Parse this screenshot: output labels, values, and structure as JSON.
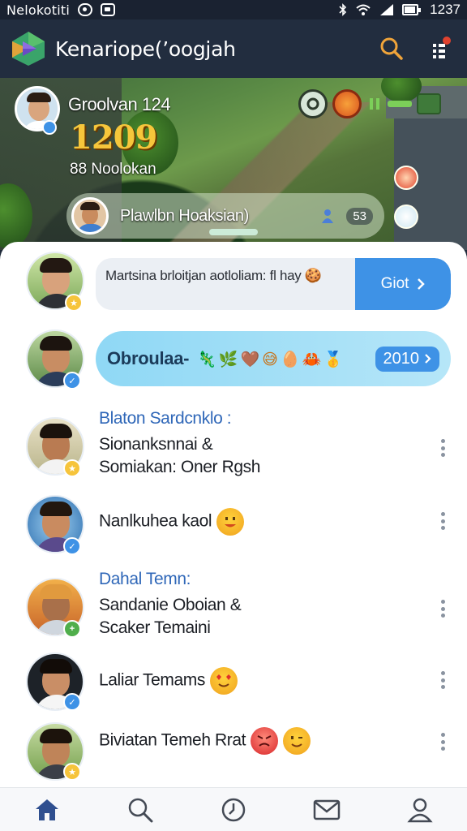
{
  "status_bar": {
    "carrier": "Nelokotiti",
    "time": "1237"
  },
  "app_bar": {
    "title": "Kenariope(’oogjah"
  },
  "banner": {
    "hero_name": "Groolvan 124",
    "hero_score": "1209",
    "hero_subtitle": "88 Noolokan",
    "chip_text": "Plawlbn Hoaksian)",
    "chip_count": "53"
  },
  "feed": {
    "message_card": {
      "text": "Martsina brloitjan aotloliam: fl hay 🍪",
      "button_label": "Giot"
    },
    "emoji_card": {
      "label": "Obroulaa-",
      "emojis": "🦎🌿🤎😅🥚🦀🥇",
      "count": "2010"
    },
    "items": [
      {
        "title": "Blaton Sardcnklo :",
        "line1": "Sionanksnnai &",
        "line2": "Somiakan: Oner Rgsh"
      },
      {
        "title": "",
        "line1": "Nanlkuhea kaol",
        "line2": ""
      },
      {
        "title": "Dahal Temn:",
        "line1": "Sandanie Oboian &",
        "line2": "Scaker Temaini"
      },
      {
        "title": "",
        "line1": "Laliar Temams",
        "line2": ""
      },
      {
        "title": "",
        "line1": "Biviatan Temeh Rrat",
        "line2": ""
      }
    ]
  },
  "colors": {
    "accent": "#3e92e6",
    "app_bar": "#222d3f",
    "title_blue": "#2f67b8"
  },
  "icons": {
    "app_logo": "play-triangle-logo-icon",
    "search": "search-icon",
    "menu": "menu-dots-icon",
    "nav": [
      "home-icon",
      "search-icon",
      "clock-icon",
      "mail-icon",
      "profile-icon"
    ]
  }
}
